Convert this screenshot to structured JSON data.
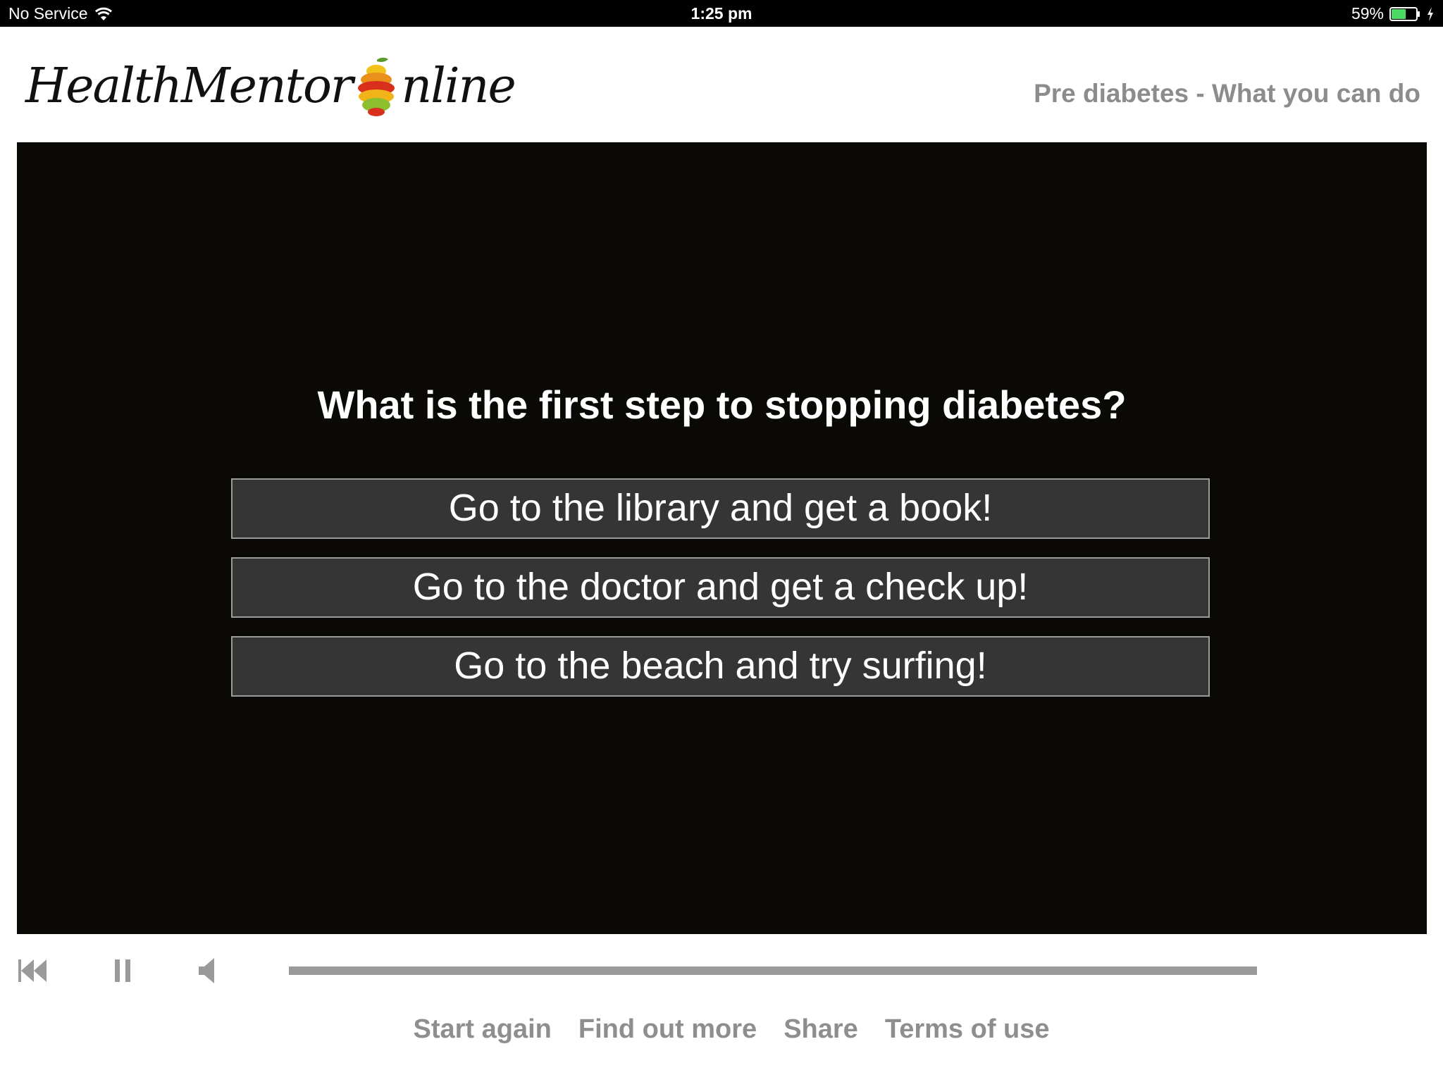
{
  "status_bar": {
    "carrier": "No Service",
    "time": "1:25 pm",
    "battery_percent": "59%",
    "battery_level": 0.59,
    "battery_color": "#4cd964"
  },
  "header": {
    "logo_left": "HealthMentor",
    "logo_right": "nline",
    "logo_icon": "fruit-stack-icon",
    "lesson_title": "Pre diabetes - What you can do"
  },
  "player": {
    "question": "What is the first step to stopping diabetes?",
    "answers": [
      "Go to the library and get a book!",
      "Go to the doctor and get a check up!",
      "Go to the beach and try surfing!"
    ]
  },
  "controls": {
    "icons": [
      "rewind-icon",
      "pause-icon",
      "volume-icon"
    ],
    "progress": 1.0
  },
  "footer": {
    "links": [
      "Start again",
      "Find out more",
      "Share",
      "Terms of use"
    ]
  }
}
